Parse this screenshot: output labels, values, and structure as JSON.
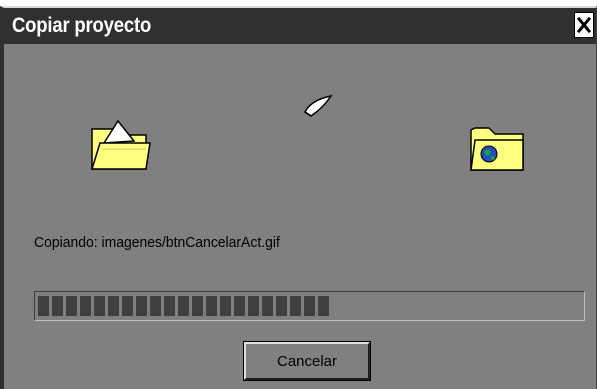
{
  "window": {
    "title": "Copiar proyecto"
  },
  "icons": {
    "source": "folder-open-icon",
    "destination": "web-folder-icon",
    "transfer": "flying-document-icon",
    "close": "close-icon"
  },
  "status": {
    "text": "Copiando: imagenes/btnCancelarAct.gif"
  },
  "progress": {
    "value": 0.55
  },
  "buttons": {
    "cancel_label": "Cancelar"
  },
  "colors": {
    "window_bg": "#808080",
    "titlebar_bg": "#303030",
    "progress_fill": "#404040",
    "folder_yellow": "#ffff80"
  }
}
